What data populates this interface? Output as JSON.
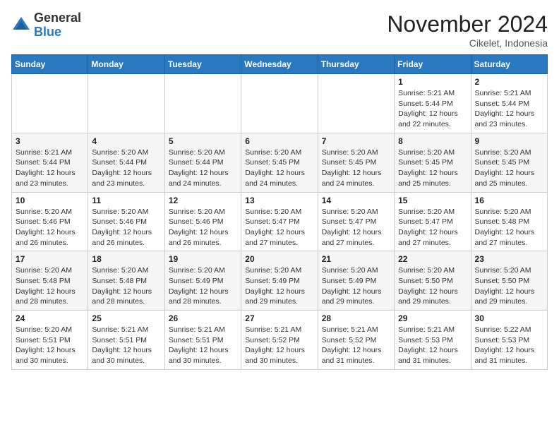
{
  "header": {
    "logo_general": "General",
    "logo_blue": "Blue",
    "month_title": "November 2024",
    "location": "Cikelet, Indonesia"
  },
  "weekdays": [
    "Sunday",
    "Monday",
    "Tuesday",
    "Wednesday",
    "Thursday",
    "Friday",
    "Saturday"
  ],
  "weeks": [
    [
      {
        "day": "",
        "info": ""
      },
      {
        "day": "",
        "info": ""
      },
      {
        "day": "",
        "info": ""
      },
      {
        "day": "",
        "info": ""
      },
      {
        "day": "",
        "info": ""
      },
      {
        "day": "1",
        "info": "Sunrise: 5:21 AM\nSunset: 5:44 PM\nDaylight: 12 hours\nand 22 minutes."
      },
      {
        "day": "2",
        "info": "Sunrise: 5:21 AM\nSunset: 5:44 PM\nDaylight: 12 hours\nand 23 minutes."
      }
    ],
    [
      {
        "day": "3",
        "info": "Sunrise: 5:21 AM\nSunset: 5:44 PM\nDaylight: 12 hours\nand 23 minutes."
      },
      {
        "day": "4",
        "info": "Sunrise: 5:20 AM\nSunset: 5:44 PM\nDaylight: 12 hours\nand 23 minutes."
      },
      {
        "day": "5",
        "info": "Sunrise: 5:20 AM\nSunset: 5:44 PM\nDaylight: 12 hours\nand 24 minutes."
      },
      {
        "day": "6",
        "info": "Sunrise: 5:20 AM\nSunset: 5:45 PM\nDaylight: 12 hours\nand 24 minutes."
      },
      {
        "day": "7",
        "info": "Sunrise: 5:20 AM\nSunset: 5:45 PM\nDaylight: 12 hours\nand 24 minutes."
      },
      {
        "day": "8",
        "info": "Sunrise: 5:20 AM\nSunset: 5:45 PM\nDaylight: 12 hours\nand 25 minutes."
      },
      {
        "day": "9",
        "info": "Sunrise: 5:20 AM\nSunset: 5:45 PM\nDaylight: 12 hours\nand 25 minutes."
      }
    ],
    [
      {
        "day": "10",
        "info": "Sunrise: 5:20 AM\nSunset: 5:46 PM\nDaylight: 12 hours\nand 26 minutes."
      },
      {
        "day": "11",
        "info": "Sunrise: 5:20 AM\nSunset: 5:46 PM\nDaylight: 12 hours\nand 26 minutes."
      },
      {
        "day": "12",
        "info": "Sunrise: 5:20 AM\nSunset: 5:46 PM\nDaylight: 12 hours\nand 26 minutes."
      },
      {
        "day": "13",
        "info": "Sunrise: 5:20 AM\nSunset: 5:47 PM\nDaylight: 12 hours\nand 27 minutes."
      },
      {
        "day": "14",
        "info": "Sunrise: 5:20 AM\nSunset: 5:47 PM\nDaylight: 12 hours\nand 27 minutes."
      },
      {
        "day": "15",
        "info": "Sunrise: 5:20 AM\nSunset: 5:47 PM\nDaylight: 12 hours\nand 27 minutes."
      },
      {
        "day": "16",
        "info": "Sunrise: 5:20 AM\nSunset: 5:48 PM\nDaylight: 12 hours\nand 27 minutes."
      }
    ],
    [
      {
        "day": "17",
        "info": "Sunrise: 5:20 AM\nSunset: 5:48 PM\nDaylight: 12 hours\nand 28 minutes."
      },
      {
        "day": "18",
        "info": "Sunrise: 5:20 AM\nSunset: 5:48 PM\nDaylight: 12 hours\nand 28 minutes."
      },
      {
        "day": "19",
        "info": "Sunrise: 5:20 AM\nSunset: 5:49 PM\nDaylight: 12 hours\nand 28 minutes."
      },
      {
        "day": "20",
        "info": "Sunrise: 5:20 AM\nSunset: 5:49 PM\nDaylight: 12 hours\nand 29 minutes."
      },
      {
        "day": "21",
        "info": "Sunrise: 5:20 AM\nSunset: 5:49 PM\nDaylight: 12 hours\nand 29 minutes."
      },
      {
        "day": "22",
        "info": "Sunrise: 5:20 AM\nSunset: 5:50 PM\nDaylight: 12 hours\nand 29 minutes."
      },
      {
        "day": "23",
        "info": "Sunrise: 5:20 AM\nSunset: 5:50 PM\nDaylight: 12 hours\nand 29 minutes."
      }
    ],
    [
      {
        "day": "24",
        "info": "Sunrise: 5:20 AM\nSunset: 5:51 PM\nDaylight: 12 hours\nand 30 minutes."
      },
      {
        "day": "25",
        "info": "Sunrise: 5:21 AM\nSunset: 5:51 PM\nDaylight: 12 hours\nand 30 minutes."
      },
      {
        "day": "26",
        "info": "Sunrise: 5:21 AM\nSunset: 5:51 PM\nDaylight: 12 hours\nand 30 minutes."
      },
      {
        "day": "27",
        "info": "Sunrise: 5:21 AM\nSunset: 5:52 PM\nDaylight: 12 hours\nand 30 minutes."
      },
      {
        "day": "28",
        "info": "Sunrise: 5:21 AM\nSunset: 5:52 PM\nDaylight: 12 hours\nand 31 minutes."
      },
      {
        "day": "29",
        "info": "Sunrise: 5:21 AM\nSunset: 5:53 PM\nDaylight: 12 hours\nand 31 minutes."
      },
      {
        "day": "30",
        "info": "Sunrise: 5:22 AM\nSunset: 5:53 PM\nDaylight: 12 hours\nand 31 minutes."
      }
    ]
  ]
}
